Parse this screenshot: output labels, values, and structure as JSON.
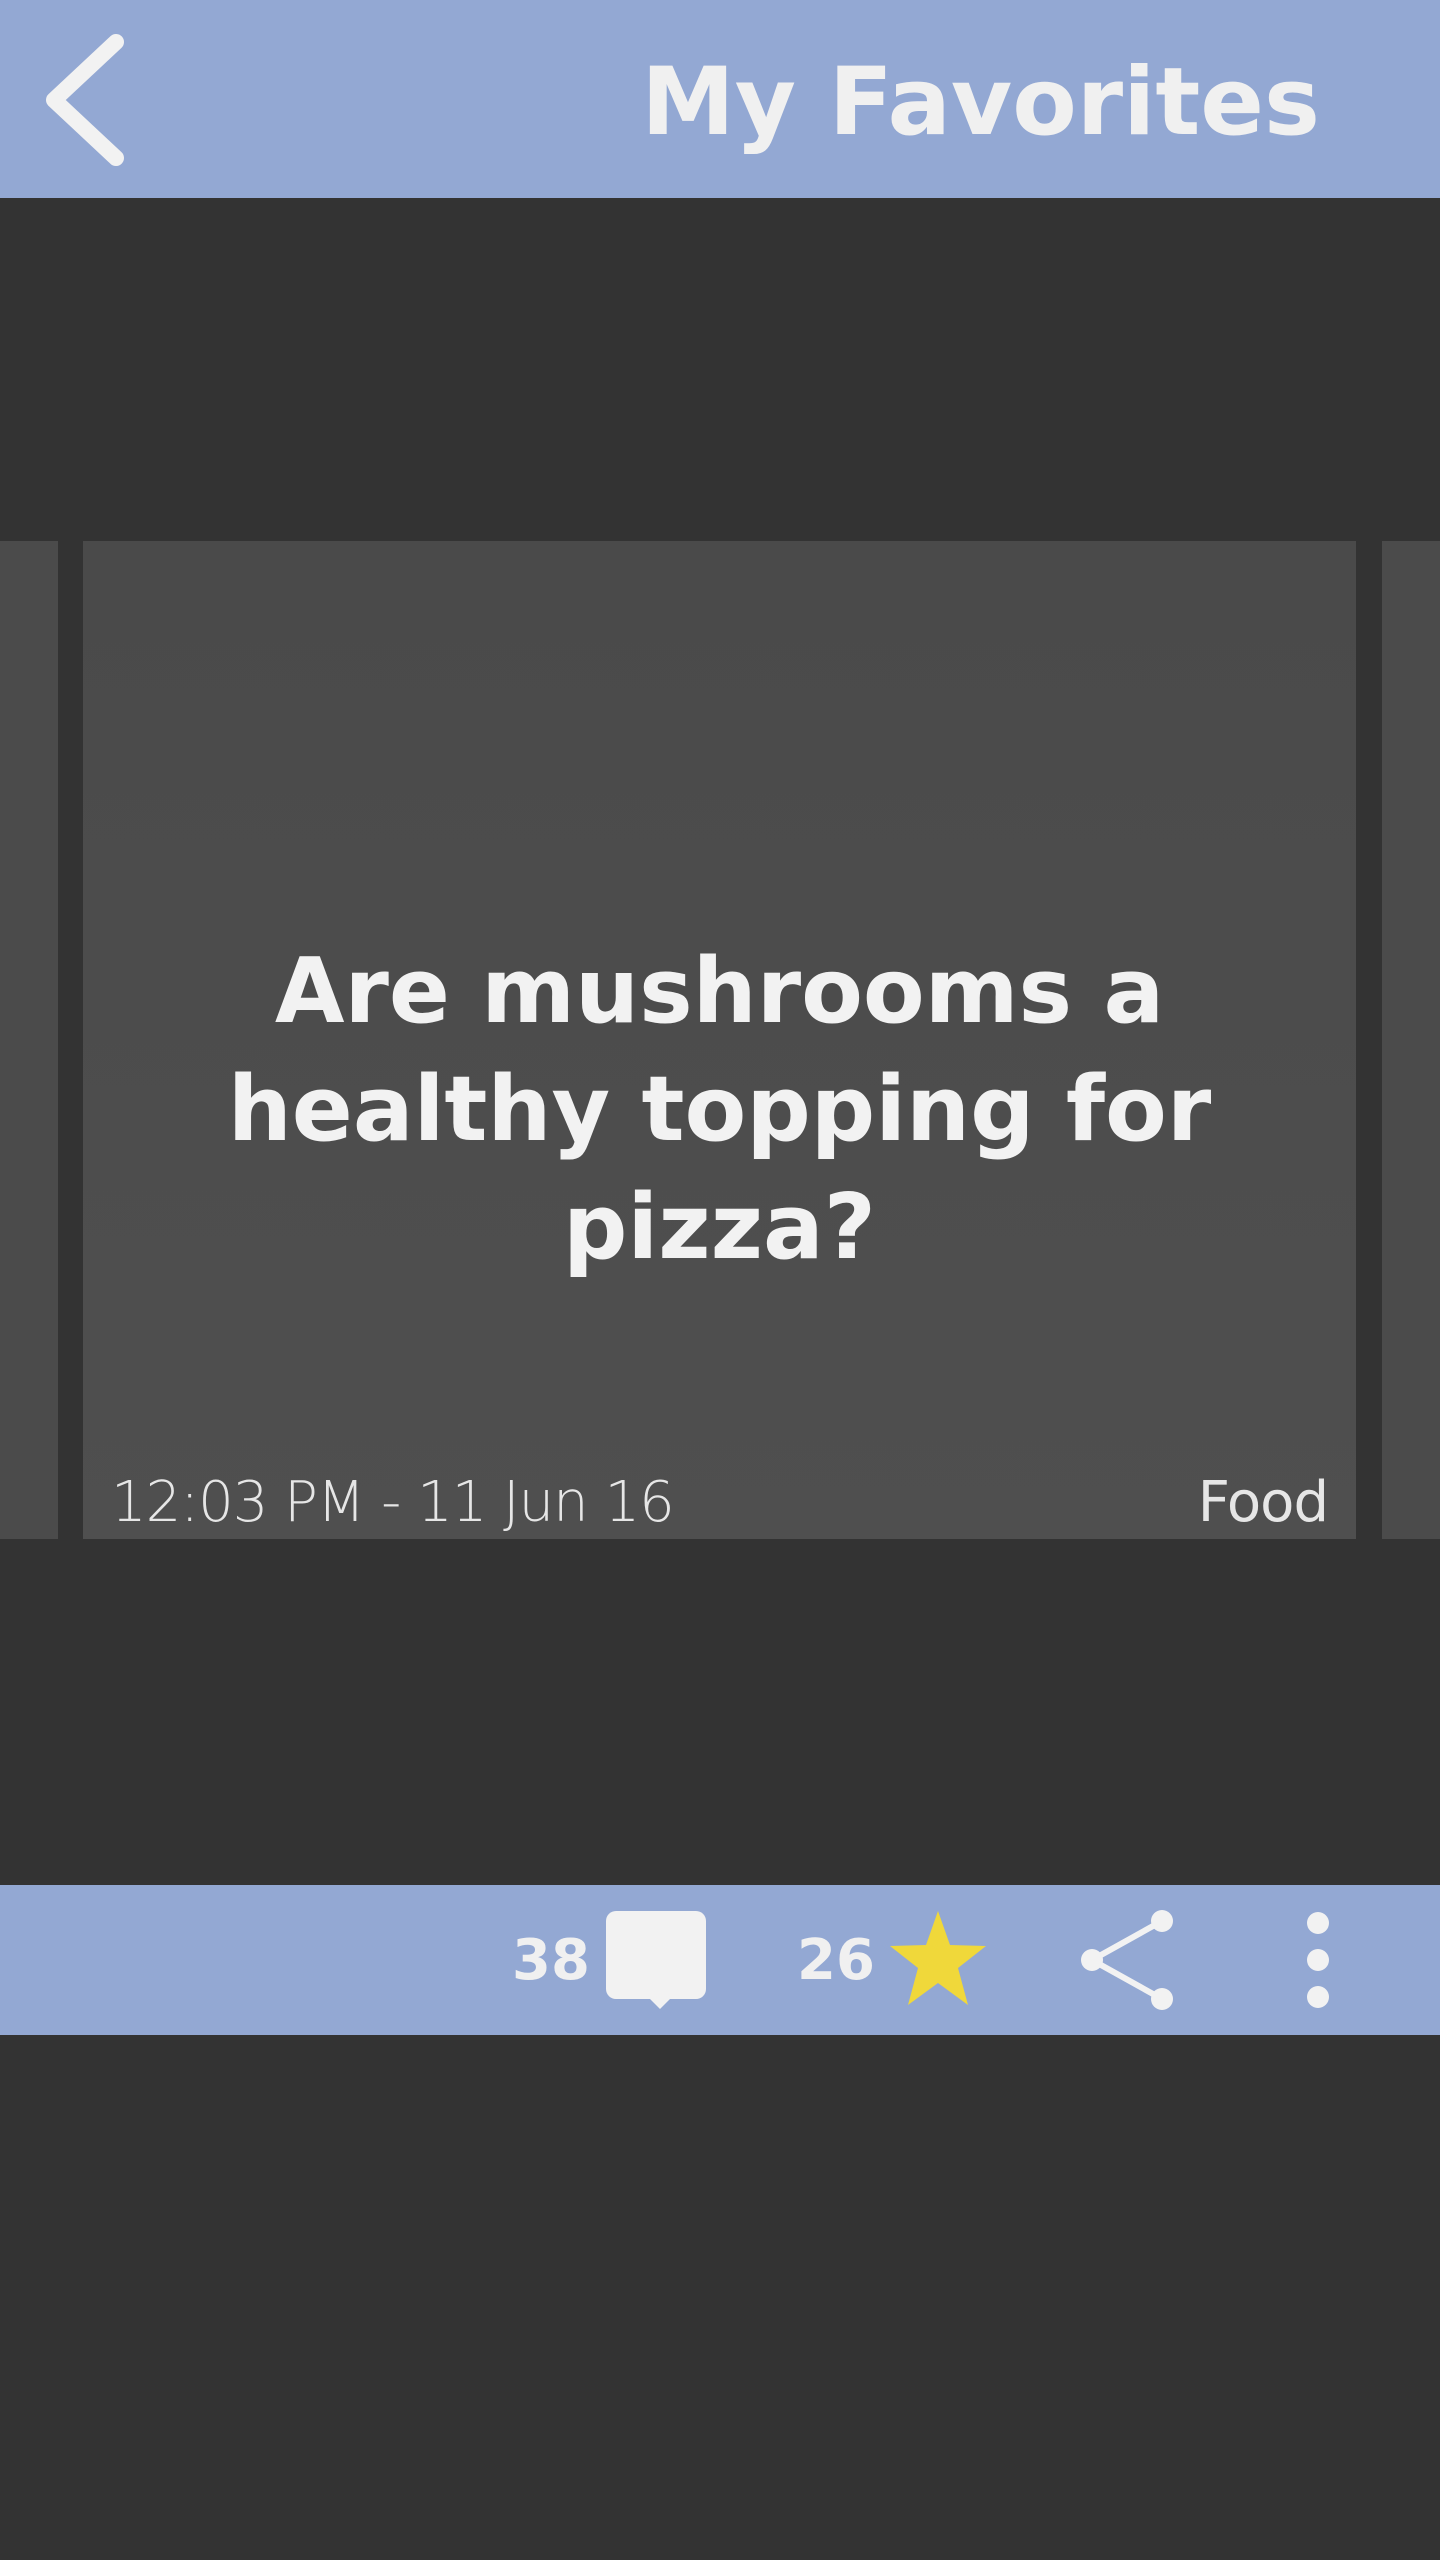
{
  "header": {
    "title": "My Favorites",
    "back_icon": "chevron-left-icon"
  },
  "card": {
    "question": "Are mushrooms a healthy topping for pizza?",
    "timestamp": "12:03 PM - 11 Jun 16",
    "category": "Food"
  },
  "actions": {
    "comment_count": "38",
    "favorite_count": "26",
    "comment_icon": "comment-icon",
    "star_icon": "star-icon",
    "share_icon": "share-icon",
    "more_icon": "more-vertical-icon"
  },
  "colors": {
    "bar": "#93a8d3",
    "background": "#333333",
    "card": "#4b4b4b",
    "star": "#f0d83a",
    "text": "#f0f0f0"
  }
}
